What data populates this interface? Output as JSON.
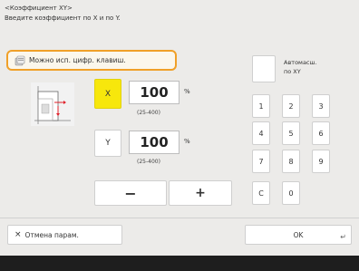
{
  "header": {
    "title": "<Коэффициент XY>",
    "subtitle": "Введите коэффициент по X и по Y."
  },
  "hint": {
    "text": "Можно исп. цифр. клавиш."
  },
  "x_axis": {
    "label": "X",
    "value": "100",
    "unit": "%",
    "range": "(25-400)"
  },
  "y_axis": {
    "label": "Y",
    "value": "100",
    "unit": "%",
    "range": "(25-400)"
  },
  "adjust": {
    "minus_label": "−",
    "plus_label": "+"
  },
  "auto_fit": {
    "label_line1": "Автомасш.",
    "label_line2": "по XY"
  },
  "keypad": {
    "k1": "1",
    "k2": "2",
    "k3": "3",
    "k4": "4",
    "k5": "5",
    "k6": "6",
    "k7": "7",
    "k8": "8",
    "k9": "9",
    "kc": "C",
    "k0": "0"
  },
  "footer": {
    "cancel_icon": "×",
    "cancel_label": "Отмена парам.",
    "ok_label": "OK"
  },
  "colors": {
    "active": "#f7e70c",
    "highlight_border": "#f0a028"
  },
  "icons": [
    "keypad-hint-icon",
    "xy-scale-diagram",
    "corner-arrow-icon"
  ]
}
